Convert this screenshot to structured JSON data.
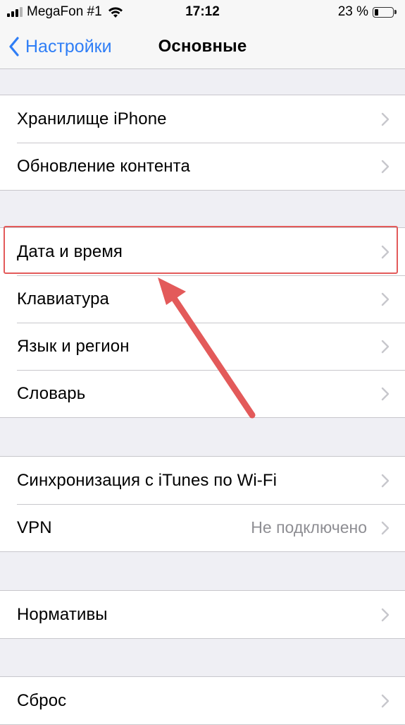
{
  "status_bar": {
    "carrier": "MegaFon #1",
    "time": "17:12",
    "battery_percent": "23 %",
    "battery_level": 0.23,
    "signal_bars_filled": 3,
    "signal_bars_total": 4,
    "icons": [
      "signal-bars-icon",
      "wifi-icon",
      "battery-icon"
    ]
  },
  "nav": {
    "back_label": "Настройки",
    "title": "Основные",
    "back_icon": "chevron-left-icon",
    "accent_color": "#2f7ef6"
  },
  "groups": [
    {
      "rows": [
        {
          "label": "Хранилище iPhone"
        },
        {
          "label": "Обновление контента"
        }
      ]
    },
    {
      "rows": [
        {
          "label": "Дата и время"
        },
        {
          "label": "Клавиатура"
        },
        {
          "label": "Язык и регион"
        },
        {
          "label": "Словарь"
        }
      ]
    },
    {
      "rows": [
        {
          "label": "Синхронизация с iTunes по Wi-Fi"
        },
        {
          "label": "VPN",
          "detail": "Не подключено"
        }
      ]
    },
    {
      "rows": [
        {
          "label": "Нормативы"
        }
      ]
    },
    {
      "rows": [
        {
          "label": "Сброс"
        }
      ]
    }
  ],
  "annotation": {
    "highlighted_item": "Дата и время",
    "color": "#e35a5a"
  }
}
